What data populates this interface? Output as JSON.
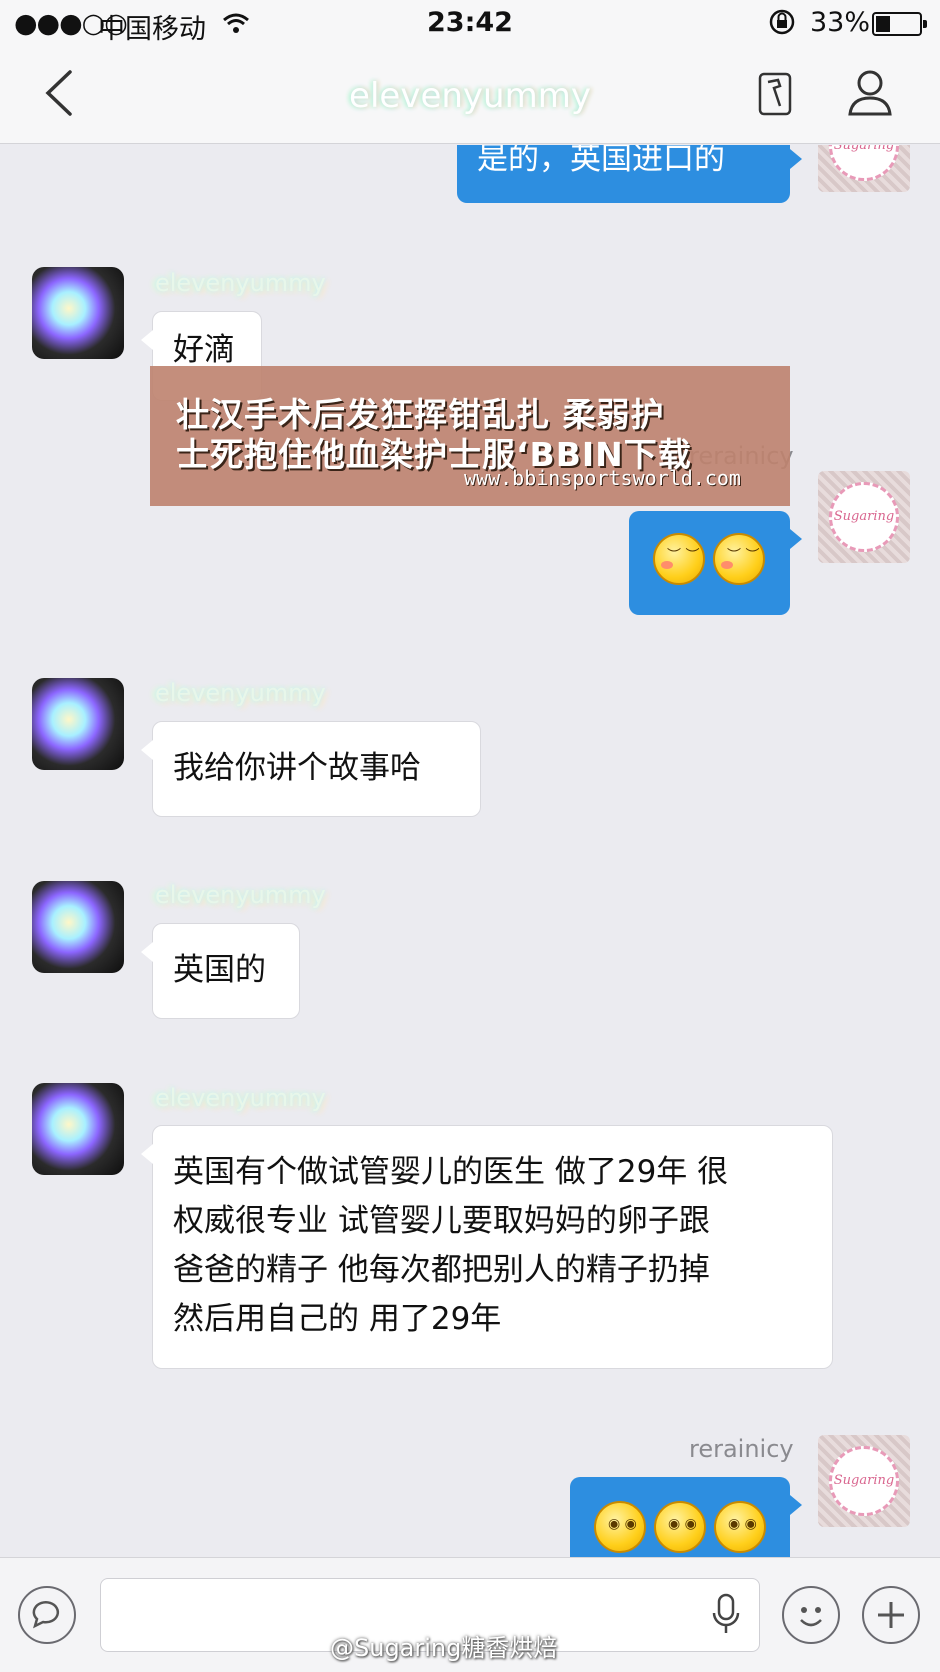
{
  "status_bar": {
    "signal": "●●●○○",
    "carrier": "中国移动",
    "time": "23:42",
    "battery_percent": "33%",
    "battery_level": 0.33
  },
  "nav": {
    "title": "elevenyummy"
  },
  "messages": [
    {
      "side": "right",
      "text": "是的，英国进口的"
    },
    {
      "side": "left",
      "sender": "elevenyummy",
      "text": "好滴"
    },
    {
      "side": "right",
      "sender": "rerainicy",
      "emojis": [
        "smile-blush",
        "smile-blush"
      ]
    },
    {
      "side": "left",
      "sender": "elevenyummy",
      "text": "我给你讲个故事哈"
    },
    {
      "side": "left",
      "sender": "elevenyummy",
      "text": "英国的"
    },
    {
      "side": "left",
      "sender": "elevenyummy",
      "lines": [
        "英国有个做试管婴儿的医生 做了29年 很",
        "权威很专业 试管婴儿要取妈妈的卵子跟",
        "爸爸的精子 他每次都把别人的精子扔掉",
        "然后用自己的 用了29年"
      ]
    },
    {
      "side": "right",
      "sender": "rerainicy",
      "emojis": [
        "shocked-face",
        "shocked-face",
        "shocked-face"
      ]
    }
  ],
  "overlay": {
    "line1": "壮汉手术后发狂挥钳乱扎 柔弱护",
    "line2": "士死抱住他血染护士服‘BBIN下载",
    "url": "www.bbinsportsworld.com"
  },
  "avatar_text": "Sugaring",
  "input_bar": {
    "watermark": "@Sugaring糖稥烘焙"
  },
  "colors": {
    "bubble_right": "#2d8ee0",
    "background": "#ebebf0"
  }
}
